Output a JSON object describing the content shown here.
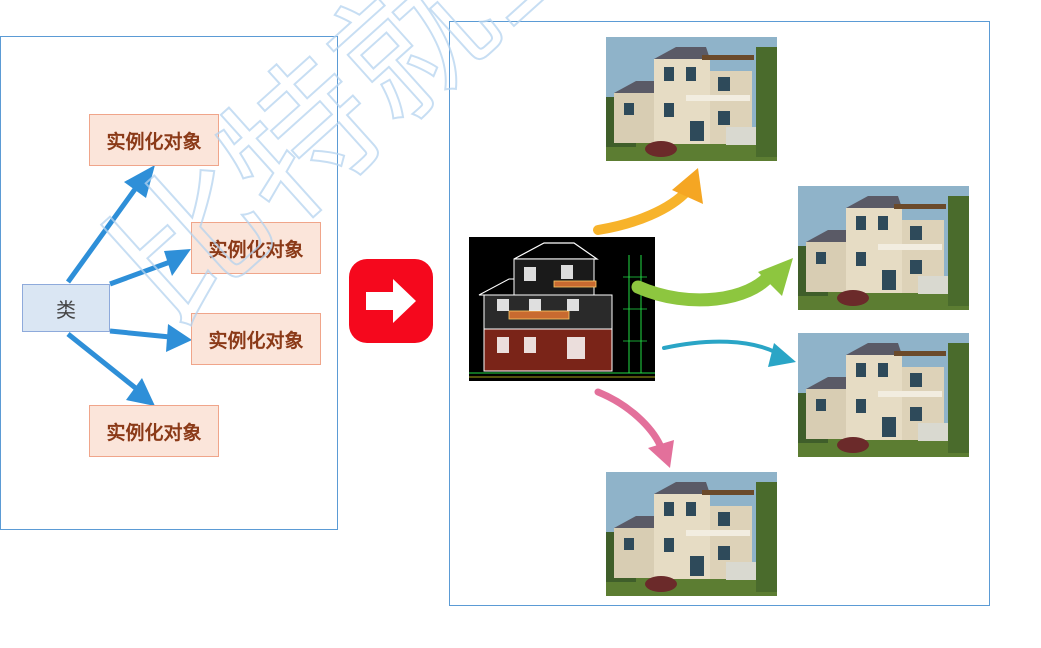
{
  "left_diagram": {
    "class_label": "类",
    "object_labels": [
      "实例化对象",
      "实例化对象",
      "实例化对象",
      "实例化对象"
    ]
  },
  "watermark_text": "比特就业",
  "colors": {
    "panel_border": "#5b9bd5",
    "class_fill": "#dae6f3",
    "object_fill": "#fbe5da",
    "object_text": "#8b3a18",
    "left_arrows": "#2e8fd8",
    "red_button": "#f5081d",
    "arrow_orange": "#f7b32b",
    "arrow_green": "#8dc63f",
    "arrow_teal": "#2aa5c6",
    "arrow_pink": "#e3709b"
  },
  "icons": {
    "transition": "right-arrow-icon"
  }
}
